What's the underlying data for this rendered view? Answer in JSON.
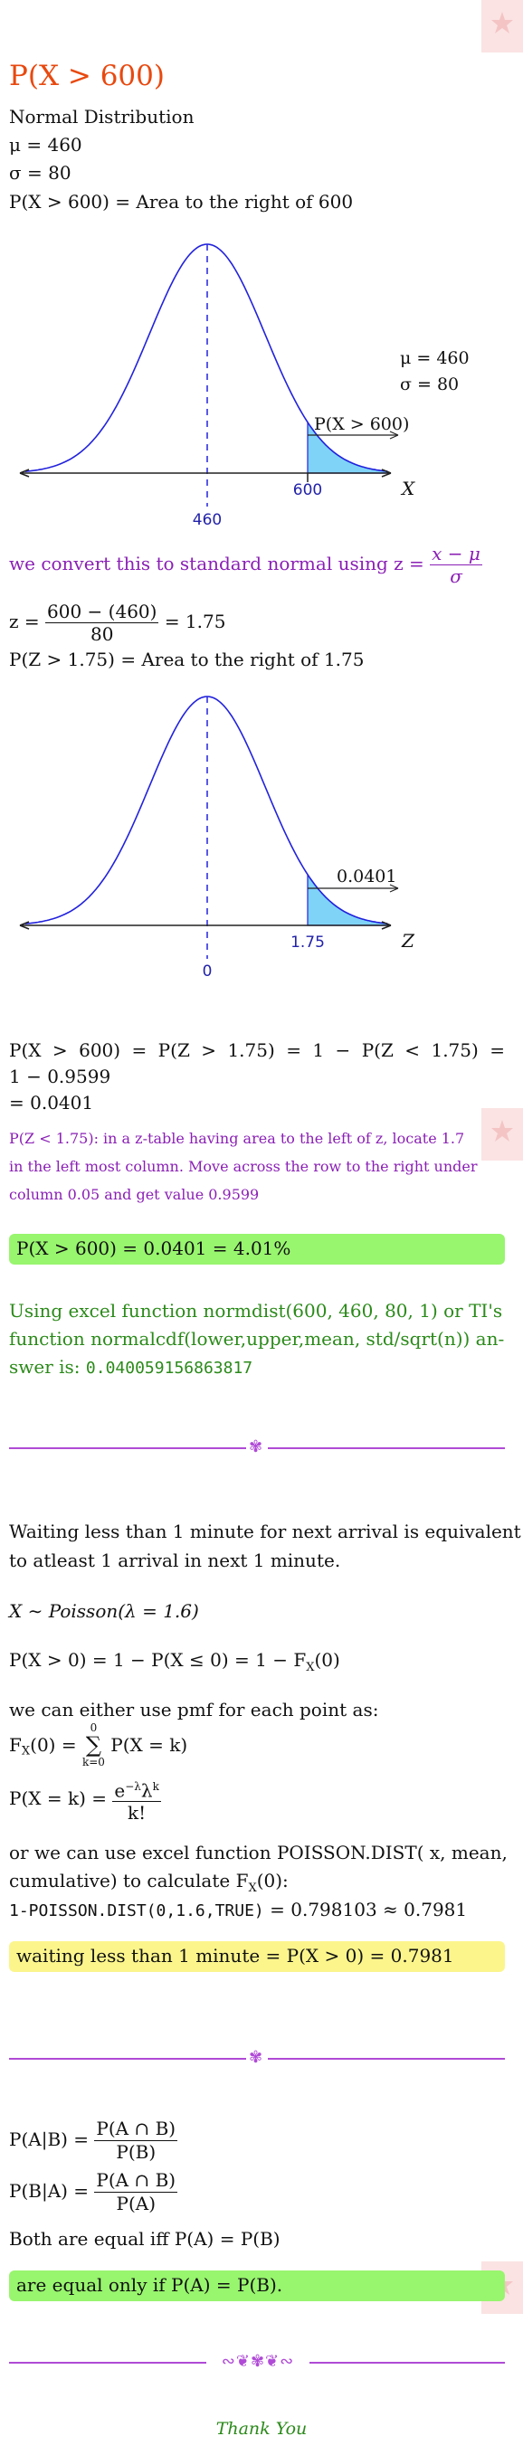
{
  "header": {
    "title": "P(X > 600)"
  },
  "part1": {
    "dist_name": "Normal Distribution",
    "mu": "μ = 460",
    "sigma": "σ = 80",
    "area_desc": "P(X > 600) = Area to the right of 600",
    "graph1": {
      "mu_label": "μ = 460",
      "sigma_label": "σ = 80",
      "shade_label": "P(X > 600)",
      "tick_mean": "460",
      "tick_value": "600",
      "axis_label": "X"
    },
    "convert_text": "we convert this to standard normal using z =",
    "convert_num": "x − μ",
    "convert_den": "σ",
    "z_prefix": "z =",
    "z_num": "600 − (460)",
    "z_den": "80",
    "z_result": "= 1.75",
    "z_area_desc": "P(Z > 1.75) = Area to the right of 1.75",
    "graph2": {
      "shade_label": "0.0401",
      "tick_mean": "0",
      "tick_value": "1.75",
      "axis_label": "Z"
    },
    "calc_line1": "P(X > 600) = P(Z > 1.75) = 1 − P(Z < 1.75) =",
    "calc_line2": "1 − 0.9599",
    "calc_line3": "= 0.0401",
    "ztable_line1": "P(Z < 1.75): in a z-table having area to the left of z, locate 1.7",
    "ztable_line2": "in the left most column. Move across the row to the right under",
    "ztable_line3": "column 0.05 and get value 0.9599",
    "answer": "P(X > 600) = 0.0401 = 4.01%",
    "excel_line1": "Using excel function normdist(600, 460, 80, 1) or TI's",
    "excel_line2": "function normalcdf(lower,upper,mean, std/sqrt(n)) an-",
    "excel_line3_prefix": "swer is:",
    "excel_value": "0.040059156863817"
  },
  "part2": {
    "intro_line1": "Waiting less than 1 minute for next arrival is equivalent",
    "intro_line2": "to atleast 1 arrival in next 1 minute.",
    "dist": "X ∼ Poisson(λ = 1.6)",
    "prob": "P(X > 0) = 1 − P(X ≤ 0) = 1 − F",
    "prob_sub": "X",
    "prob_tail": "(0)",
    "pmf_intro": "we can either use pmf for each point as:",
    "cdf_lhs": "F",
    "cdf_sub": "X",
    "cdf_mid": "(0) =",
    "sum_top": "0",
    "sum_bottom": "k=0",
    "cdf_rhs": "P(X = k)",
    "pmf_lhs": "P(X = k) =",
    "pmf_num": "e",
    "pmf_num_sup": "−λ",
    "pmf_num_tail": "λ",
    "pmf_num_sup2": "k",
    "pmf_den": "k!",
    "excel_line1": "or we can use excel function POISSON.DIST( x, mean,",
    "excel_line2": "cumulative) to calculate F",
    "excel_line2_sub": "X",
    "excel_line2_tail": "(0):",
    "excel_formula": "1-POISSON.DIST(0,1.6,TRUE)",
    "excel_result": "= 0.798103 ≈ 0.7981",
    "answer": "waiting less than 1 minute = P(X > 0) = 0.7981"
  },
  "part3": {
    "eq1_lhs": "P(A|B) =",
    "eq1_num": "P(A ∩ B)",
    "eq1_den": "P(B)",
    "eq2_lhs": "P(B|A) =",
    "eq2_num": "P(A ∩ B)",
    "eq2_den": "P(A)",
    "statement": "Both are equal iff P(A) = P(B)",
    "answer": "are equal only if P(A) = P(B)."
  },
  "footer": {
    "thanks": "Thank You"
  },
  "colors": {
    "title": "#e8490f",
    "purple": "#8a1fb5",
    "green": "#2b8a1a",
    "curve": "#2222dd",
    "shade": "#7fd3f7"
  }
}
